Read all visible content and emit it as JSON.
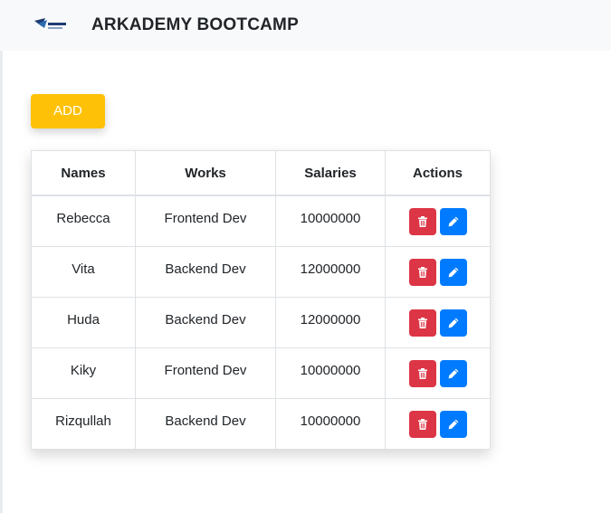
{
  "navbar": {
    "title": "ARKADEMY BOOTCAMP",
    "logo_icon": "arkademy-logo"
  },
  "toolbar": {
    "add_label": "ADD"
  },
  "table": {
    "headers": [
      "Names",
      "Works",
      "Salaries",
      "Actions"
    ],
    "rows": [
      {
        "name": "Rebecca",
        "work": "Frontend Dev",
        "salary": "10000000"
      },
      {
        "name": "Vita",
        "work": "Backend Dev",
        "salary": "12000000"
      },
      {
        "name": "Huda",
        "work": "Backend Dev",
        "salary": "12000000"
      },
      {
        "name": "Kiky",
        "work": "Frontend Dev",
        "salary": "10000000"
      },
      {
        "name": "Rizqullah",
        "work": "Backend Dev",
        "salary": "10000000"
      }
    ],
    "action_icons": {
      "delete": "trash-icon",
      "edit": "pencil-icon"
    }
  },
  "colors": {
    "add": "#ffc107",
    "delete": "#dc3545",
    "edit": "#007bff",
    "navbar": "#f8f9fa"
  }
}
